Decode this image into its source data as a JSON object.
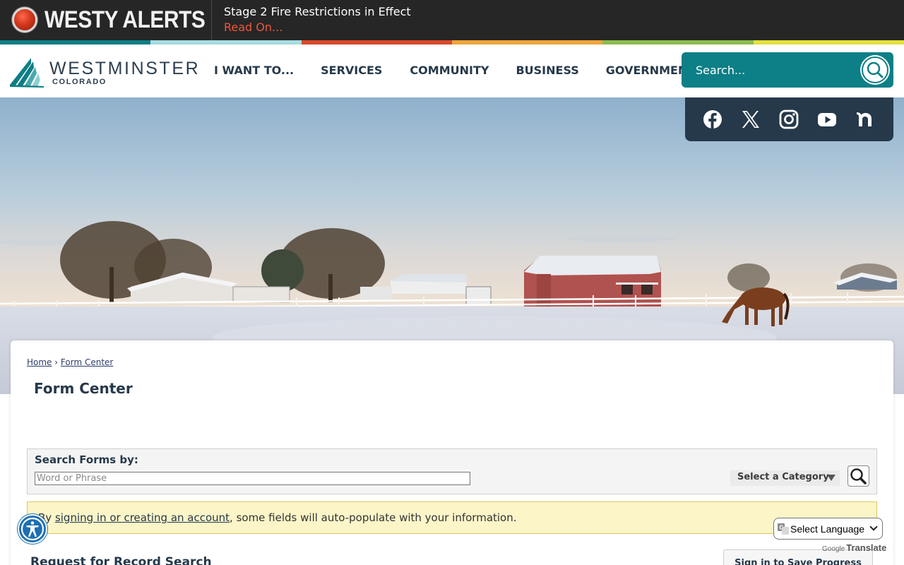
{
  "alert": {
    "brand": "WESTY ALERTS",
    "message": "Stage 2 Fire Restrictions in Effect",
    "link": "Read On..."
  },
  "brand_colors": [
    "#0d7f86",
    "#a7dde1",
    "#d94a2b",
    "#f0a53a",
    "#8dbd4f",
    "#e3e23c"
  ],
  "logo": {
    "name": "WESTMINSTER",
    "sub": "COLORADO"
  },
  "nav": {
    "items": [
      "I WANT TO...",
      "SERVICES",
      "COMMUNITY",
      "BUSINESS",
      "GOVERNMENT"
    ]
  },
  "search": {
    "placeholder": "Search..."
  },
  "social": [
    "facebook-icon",
    "x-twitter-icon",
    "instagram-icon",
    "youtube-icon",
    "nextdoor-icon"
  ],
  "breadcrumb": {
    "home": "Home",
    "separator": "›",
    "current": "Form Center"
  },
  "page": {
    "title": "Form Center"
  },
  "search_forms": {
    "label": "Search Forms by:",
    "placeholder": "Word or Phrase",
    "category": "Select a Category"
  },
  "notice": {
    "prefix": "By ",
    "link": "signing in or creating an account",
    "suffix": ", some fields will auto-populate with your information."
  },
  "form": {
    "title": "Request for Record Search",
    "save_button": "Sign in to Save Progress"
  },
  "translate": {
    "select_label": "Select Language",
    "powered_by": "Google",
    "translate_label": "Translate"
  }
}
